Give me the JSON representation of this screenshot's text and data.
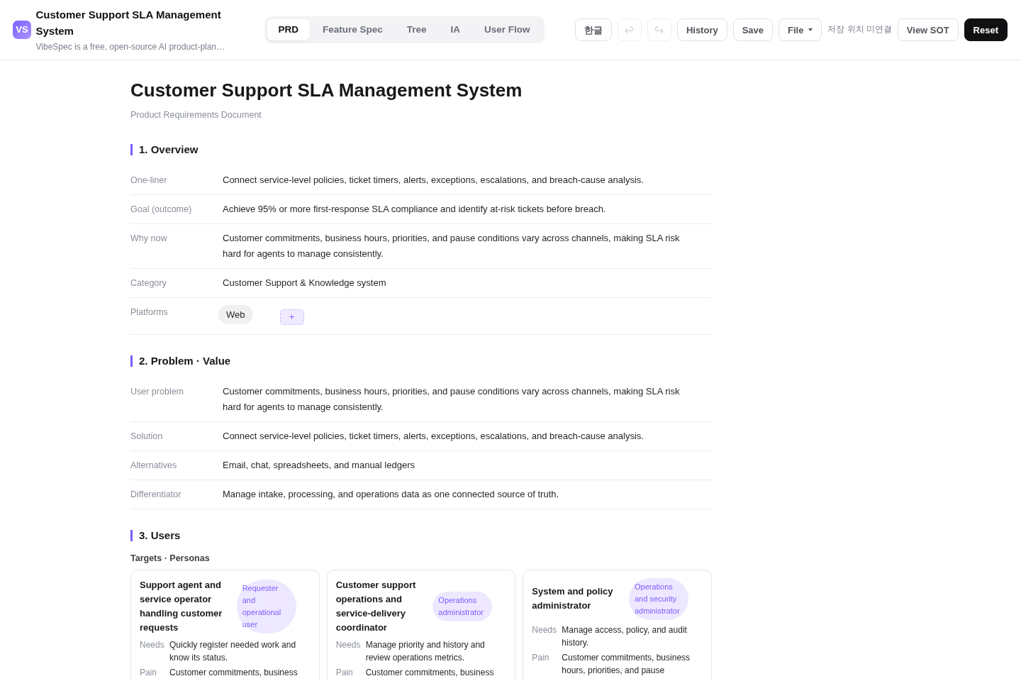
{
  "app": {
    "logo": "VS",
    "title": "Customer Support SLA Management System",
    "tagline": "VibeSpec is a free, open-source AI product-plan…"
  },
  "tabs": [
    {
      "label": "PRD",
      "selected": true
    },
    {
      "label": "Feature Spec",
      "selected": false
    },
    {
      "label": "Tree",
      "selected": false
    },
    {
      "label": "IA",
      "selected": false
    },
    {
      "label": "User Flow",
      "selected": false
    }
  ],
  "toolbar": [
    {
      "kind": "button",
      "label": "한글"
    },
    {
      "kind": "undo",
      "disabled": true
    },
    {
      "kind": "redo",
      "disabled": true
    },
    {
      "kind": "button",
      "label": "History"
    },
    {
      "kind": "button",
      "label": "Save"
    },
    {
      "kind": "dropdown",
      "label": "File"
    },
    {
      "kind": "status",
      "label": "저장 위치 미연결"
    },
    {
      "kind": "button",
      "label": "View SOT"
    },
    {
      "kind": "primary",
      "label": "Reset"
    }
  ],
  "document": {
    "title": "Customer Support SLA Management System",
    "subtitle": "Product Requirements Document",
    "sections": [
      {
        "heading": "1. Overview",
        "rows": [
          {
            "kind": "text",
            "label": "One-liner",
            "value": "Connect service-level policies, ticket timers, alerts, exceptions, escalations, and breach-cause analysis."
          },
          {
            "kind": "text",
            "label": "Goal (outcome)",
            "value": "Achieve 95% or more first-response SLA compliance and identify at-risk tickets before breach."
          },
          {
            "kind": "text",
            "label": "Why now",
            "value": "Customer commitments, business hours, priorities, and pause conditions vary across channels, making SLA risk hard for agents to manage consistently."
          },
          {
            "kind": "text",
            "label": "Category",
            "value": "Customer Support & Knowledge system"
          },
          {
            "kind": "chips",
            "label": "Platforms",
            "chips": [
              "Web"
            ],
            "add_label": "+"
          }
        ]
      },
      {
        "heading": "2. Problem · Value",
        "rows": [
          {
            "kind": "text",
            "label": "User problem",
            "value": "Customer commitments, business hours, priorities, and pause conditions vary across channels, making SLA risk hard for agents to manage consistently."
          },
          {
            "kind": "text",
            "label": "Solution",
            "value": "Connect service-level policies, ticket timers, alerts, exceptions, escalations, and breach-cause analysis."
          },
          {
            "kind": "text",
            "label": "Alternatives",
            "value": "Email, chat, spreadsheets, and manual ledgers"
          },
          {
            "kind": "text",
            "label": "Differentiator",
            "value": "Manage intake, processing, and operations data as one connected source of truth."
          }
        ]
      },
      {
        "heading": "3. Users",
        "subheading": "Targets · Personas",
        "personas": [
          {
            "name": "Support agent and service operator handling customer requests",
            "role": "Requester and operational user",
            "details": [
              {
                "label": "Needs",
                "text": "Quickly register needed work and know its status."
              },
              {
                "label": "Pain",
                "text": "Customer commitments, business"
              }
            ]
          },
          {
            "name": "Customer support operations and service-delivery coordinator",
            "role": "Operations administrator",
            "details": [
              {
                "label": "Needs",
                "text": "Manage priority and history and review operations metrics."
              },
              {
                "label": "Pain",
                "text": "Customer commitments, business"
              }
            ]
          },
          {
            "name": "System and policy administrator",
            "role": "Operations and security administrator",
            "details": [
              {
                "label": "Needs",
                "text": "Manage access, policy, and audit history."
              },
              {
                "label": "Pain",
                "text": "Customer commitments, business hours, priorities, and pause"
              }
            ]
          }
        ]
      }
    ]
  }
}
